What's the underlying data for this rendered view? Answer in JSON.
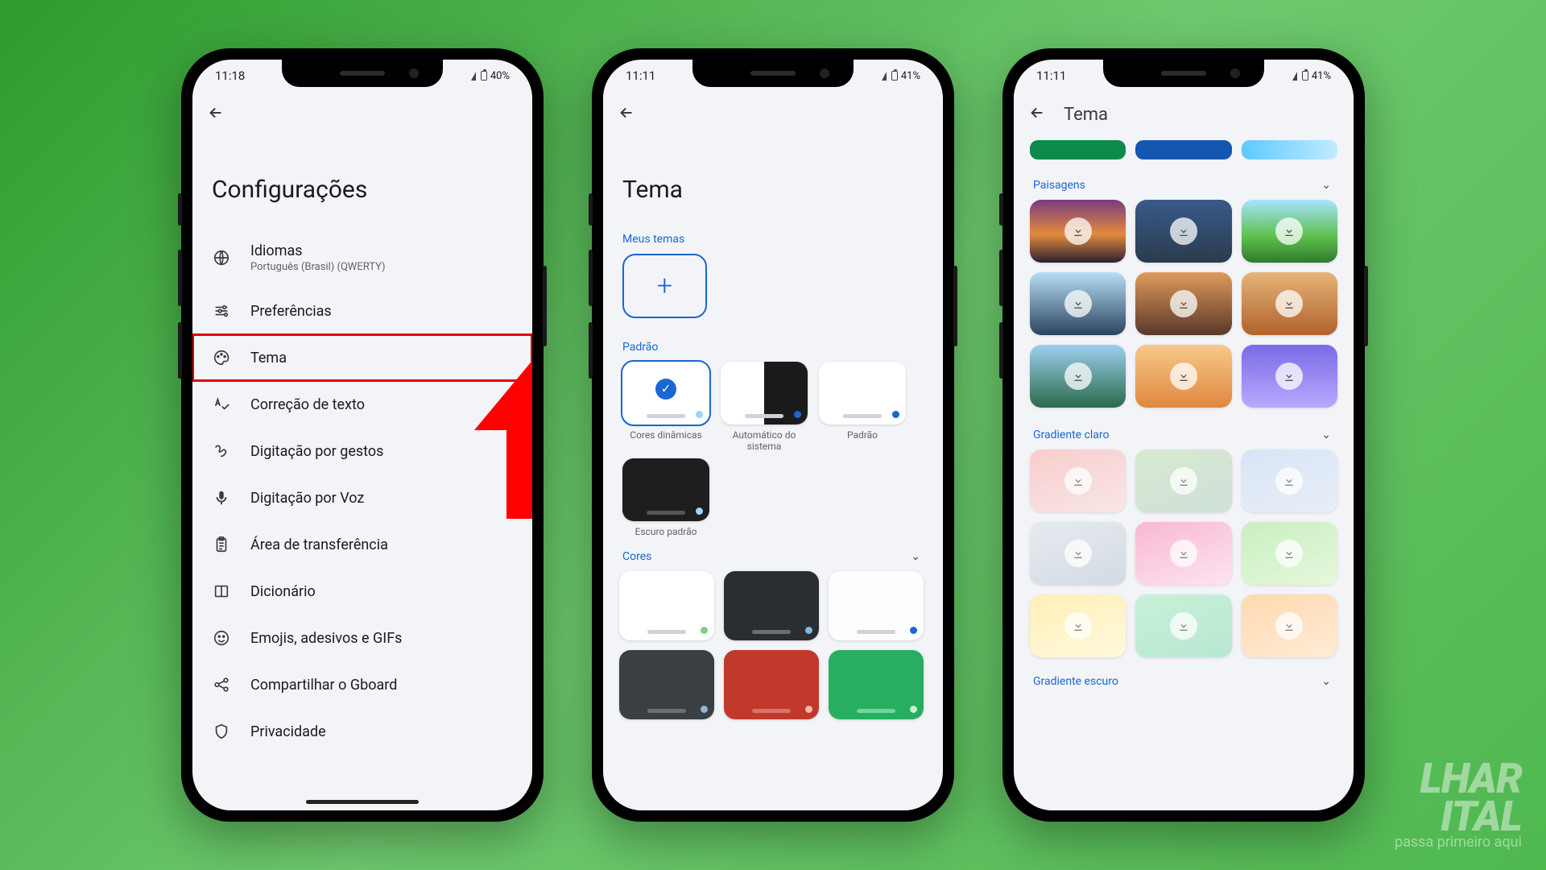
{
  "watermark": {
    "brand_fragment": "LHAR",
    "brand_fragment2": "ITAL",
    "tagline_fragment": "passa primeiro aqui"
  },
  "phone1": {
    "status": {
      "time": "11:18",
      "battery": "40%"
    },
    "page_title": "Configurações",
    "items": [
      {
        "icon": "globe",
        "label": "Idiomas",
        "sub": "Português (Brasil) (QWERTY)"
      },
      {
        "icon": "sliders",
        "label": "Preferências"
      },
      {
        "icon": "palette",
        "label": "Tema",
        "highlight": true
      },
      {
        "icon": "spellcheck",
        "label": "Correção de texto"
      },
      {
        "icon": "gesture",
        "label": "Digitação por gestos"
      },
      {
        "icon": "mic",
        "label": "Digitação por Voz"
      },
      {
        "icon": "clipboard",
        "label": "Área de transferência"
      },
      {
        "icon": "book",
        "label": "Dicionário"
      },
      {
        "icon": "emoji",
        "label": "Emojis, adesivos e GIFs"
      },
      {
        "icon": "share",
        "label": "Compartilhar o Gboard"
      },
      {
        "icon": "shield",
        "label": "Privacidade"
      }
    ]
  },
  "phone2": {
    "status": {
      "time": "11:11",
      "battery": "41%"
    },
    "page_title": "Tema",
    "sec_my": "Meus temas",
    "sec_default": "Padrão",
    "tiles": {
      "dyn": "Cores dinâmicas",
      "auto": "Automático do sistema",
      "def": "Padrão",
      "dark": "Escuro padrão"
    },
    "sec_colors": "Cores"
  },
  "phone3": {
    "status": {
      "time": "11:11",
      "battery": "41%"
    },
    "appbar_title": "Tema",
    "sec_landscape": "Paisagens",
    "sec_grad_light": "Gradiente claro",
    "sec_grad_dark": "Gradiente escuro"
  }
}
